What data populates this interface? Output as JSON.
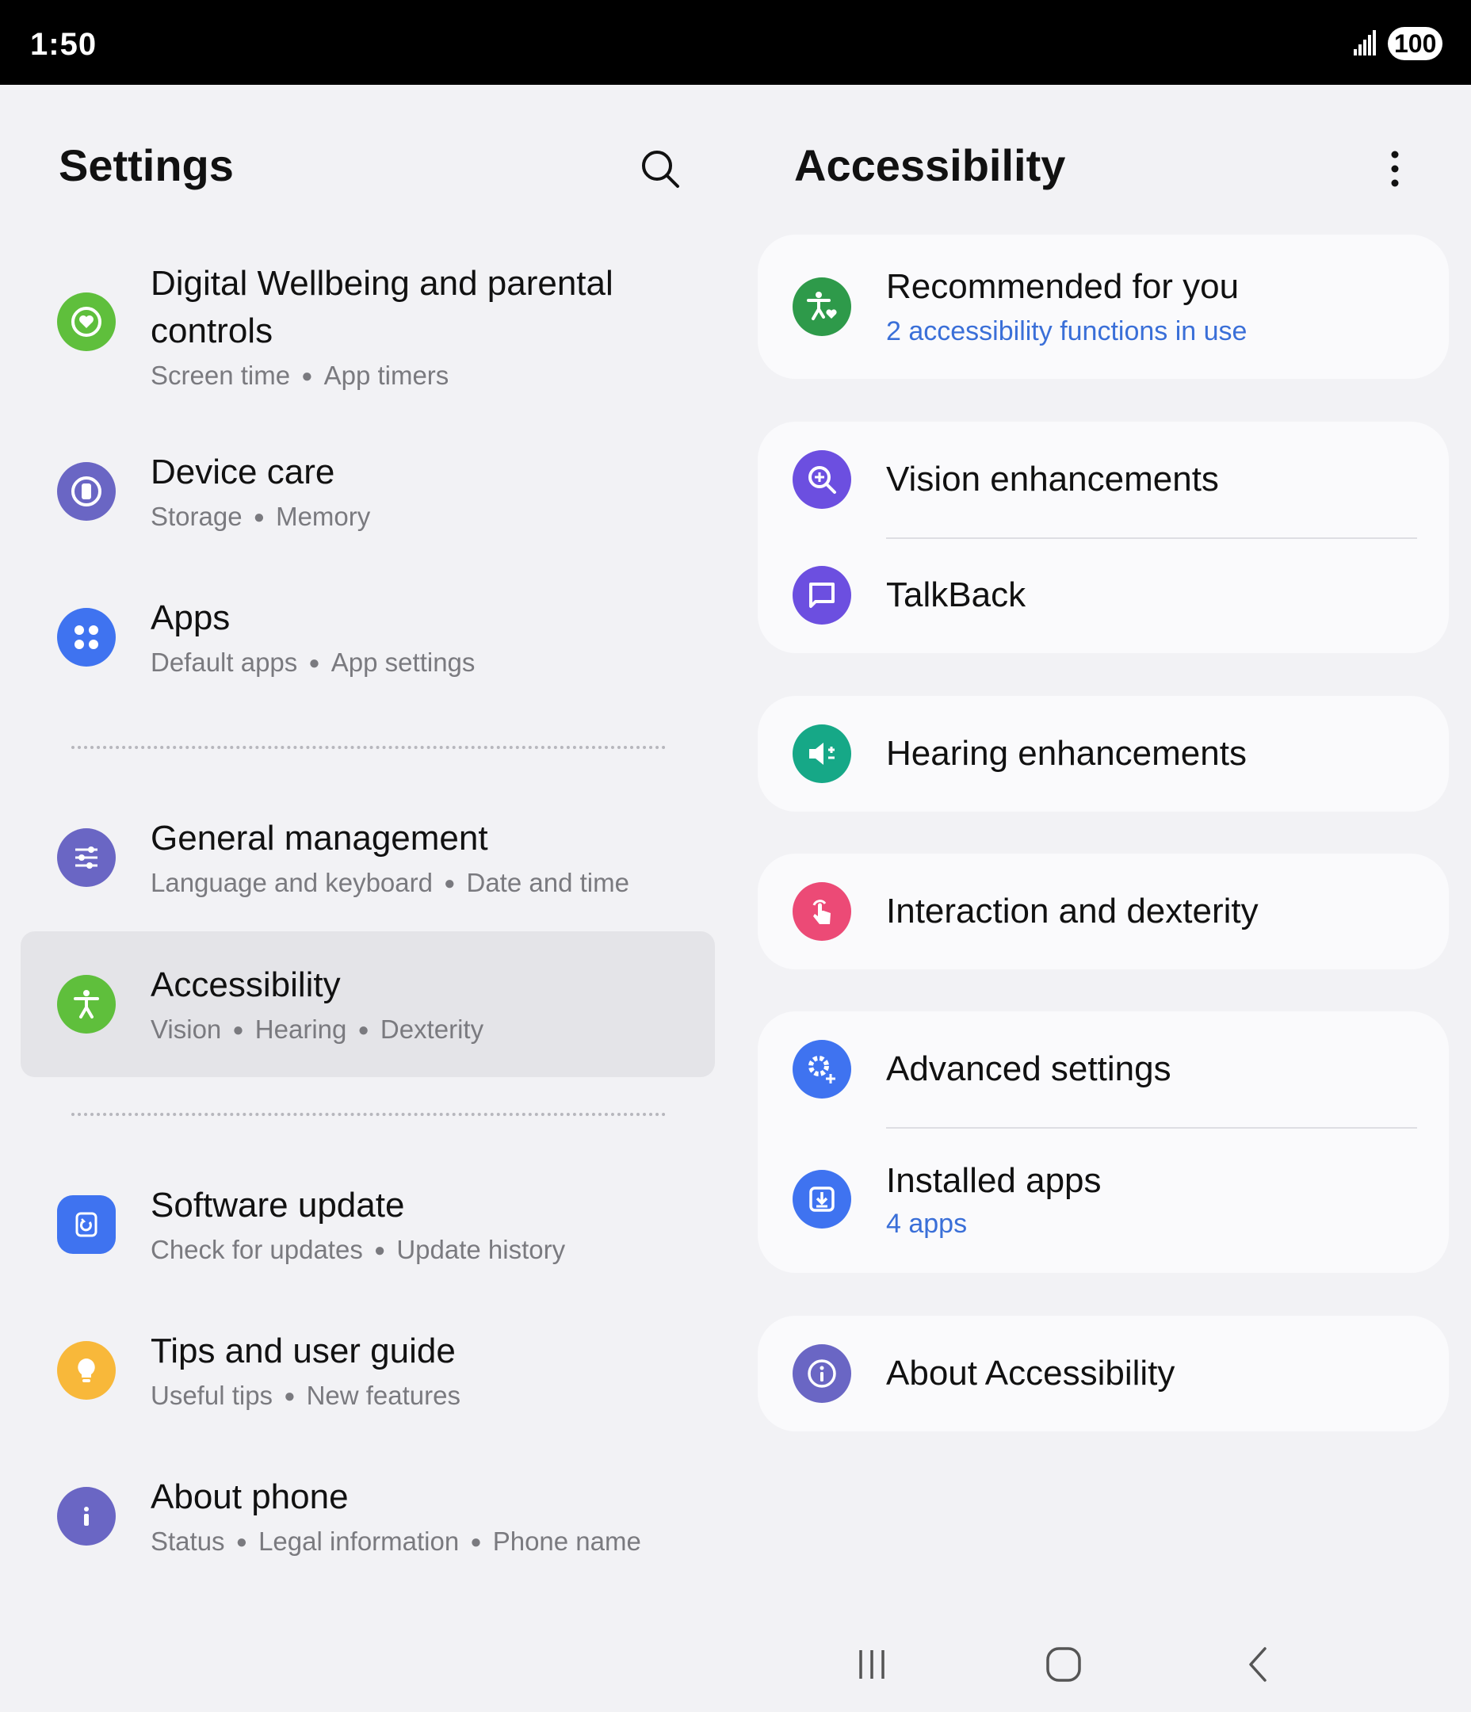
{
  "status_bar": {
    "time": "1:50",
    "battery": "100"
  },
  "left": {
    "title": "Settings",
    "items": [
      {
        "title_line1": "Digital Wellbeing and parental",
        "title_line2": "controls",
        "sub": [
          "Screen time",
          "App timers"
        ],
        "icon": "digital-wellbeing-icon",
        "color": "#5fbf3c"
      },
      {
        "title": "Device care",
        "sub": [
          "Storage",
          "Memory"
        ],
        "icon": "device-care-icon",
        "color": "#6a66c4"
      },
      {
        "title": "Apps",
        "sub": [
          "Default apps",
          "App settings"
        ],
        "icon": "apps-icon",
        "color": "#3f73f0"
      },
      {
        "title": "General management",
        "sub": [
          "Language and keyboard",
          "Date and time"
        ],
        "icon": "sliders-icon",
        "color": "#6a66c4"
      },
      {
        "title": "Accessibility",
        "sub": [
          "Vision",
          "Hearing",
          "Dexterity"
        ],
        "icon": "accessibility-icon",
        "color": "#5fbf3c"
      },
      {
        "title": "Software update",
        "sub": [
          "Check for updates",
          "Update history"
        ],
        "icon": "software-update-icon",
        "color": "#3f73f0"
      },
      {
        "title": "Tips and user guide",
        "sub": [
          "Useful tips",
          "New features"
        ],
        "icon": "lightbulb-icon",
        "color": "#f8b83a"
      },
      {
        "title": "About phone",
        "sub": [
          "Status",
          "Legal information",
          "Phone name"
        ],
        "icon": "info-icon",
        "color": "#6a66c4"
      }
    ]
  },
  "right": {
    "title": "Accessibility",
    "recommended": {
      "title": "Recommended for you",
      "sub": "2 accessibility functions in use",
      "color": "#2e9a4a"
    },
    "vision": {
      "title": "Vision enhancements",
      "color": "#6c4fe0"
    },
    "talkback": {
      "title": "TalkBack",
      "color": "#6c4fe0"
    },
    "hearing": {
      "title": "Hearing enhancements",
      "color": "#16a887"
    },
    "interaction": {
      "title": "Interaction and dexterity",
      "color": "#ec4a76"
    },
    "advanced": {
      "title": "Advanced settings",
      "color": "#3f73f0"
    },
    "installed": {
      "title": "Installed apps",
      "sub": "4 apps",
      "color": "#3f73f0"
    },
    "about": {
      "title": "About Accessibility",
      "color": "#6a66c4"
    }
  }
}
